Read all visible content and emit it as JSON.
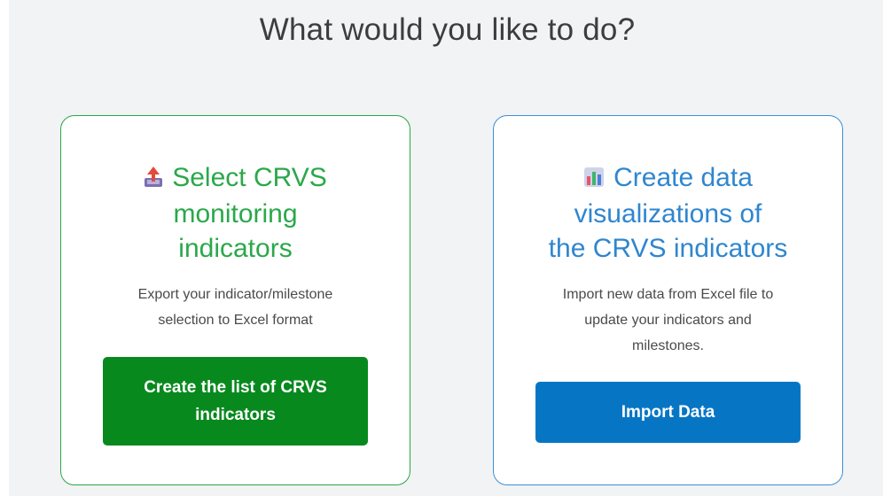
{
  "heading": "What would you like to do?",
  "cards": [
    {
      "icon": "export-tray-icon",
      "title_lines": [
        "Select CRVS",
        "monitoring",
        "indicators"
      ],
      "description_lines": [
        "Export your indicator/milestone",
        "selection to Excel format"
      ],
      "button_label_lines": [
        "Create the list of CRVS",
        "indicators"
      ],
      "accent_color": "#2aa84a",
      "button_color": "#08891e"
    },
    {
      "icon": "bar-chart-icon",
      "title_lines": [
        "Create data",
        "visualizations of",
        "the CRVS indicators"
      ],
      "description_lines": [
        "Import new data from Excel file to",
        "update your indicators and",
        "milestones."
      ],
      "button_label_lines": [
        "Import Data"
      ],
      "accent_color": "#2f86cf",
      "button_color": "#0676c4"
    }
  ]
}
